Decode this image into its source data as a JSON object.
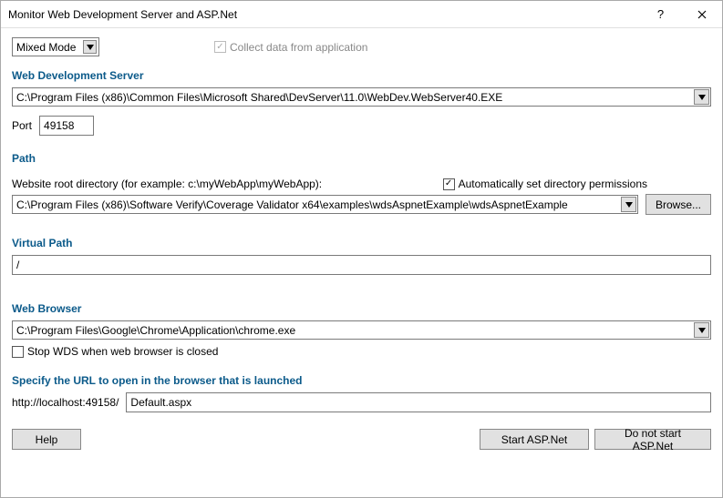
{
  "window": {
    "title": "Monitor Web Development Server and ASP.Net"
  },
  "mode": {
    "selected": "Mixed Mode"
  },
  "collectData": {
    "label": "Collect data from application",
    "checked": true
  },
  "wds": {
    "header": "Web Development Server",
    "path": "C:\\Program Files (x86)\\Common Files\\Microsoft Shared\\DevServer\\11.0\\WebDev.WebServer40.EXE",
    "portLabel": "Port",
    "port": "49158"
  },
  "pathSection": {
    "header": "Path",
    "rootLabel": "Website root directory (for example: c:\\myWebApp\\myWebApp):",
    "autoPerms": {
      "label": "Automatically set directory permissions",
      "checked": true
    },
    "root": "C:\\Program Files (x86)\\Software Verify\\Coverage Validator x64\\examples\\wdsAspnetExample\\wdsAspnetExample",
    "browse": "Browse..."
  },
  "virtualPath": {
    "header": "Virtual Path",
    "value": "/"
  },
  "browser": {
    "header": "Web Browser",
    "path": "C:\\Program Files\\Google\\Chrome\\Application\\chrome.exe",
    "stopWds": {
      "label": "Stop WDS when web browser is closed",
      "checked": false
    }
  },
  "url": {
    "header": "Specify the URL to open in the browser that is launched",
    "prefix": "http://localhost:49158/",
    "value": "Default.aspx"
  },
  "buttons": {
    "help": "Help",
    "start": "Start ASP.Net",
    "doNotStart": "Do not start ASP.Net"
  }
}
